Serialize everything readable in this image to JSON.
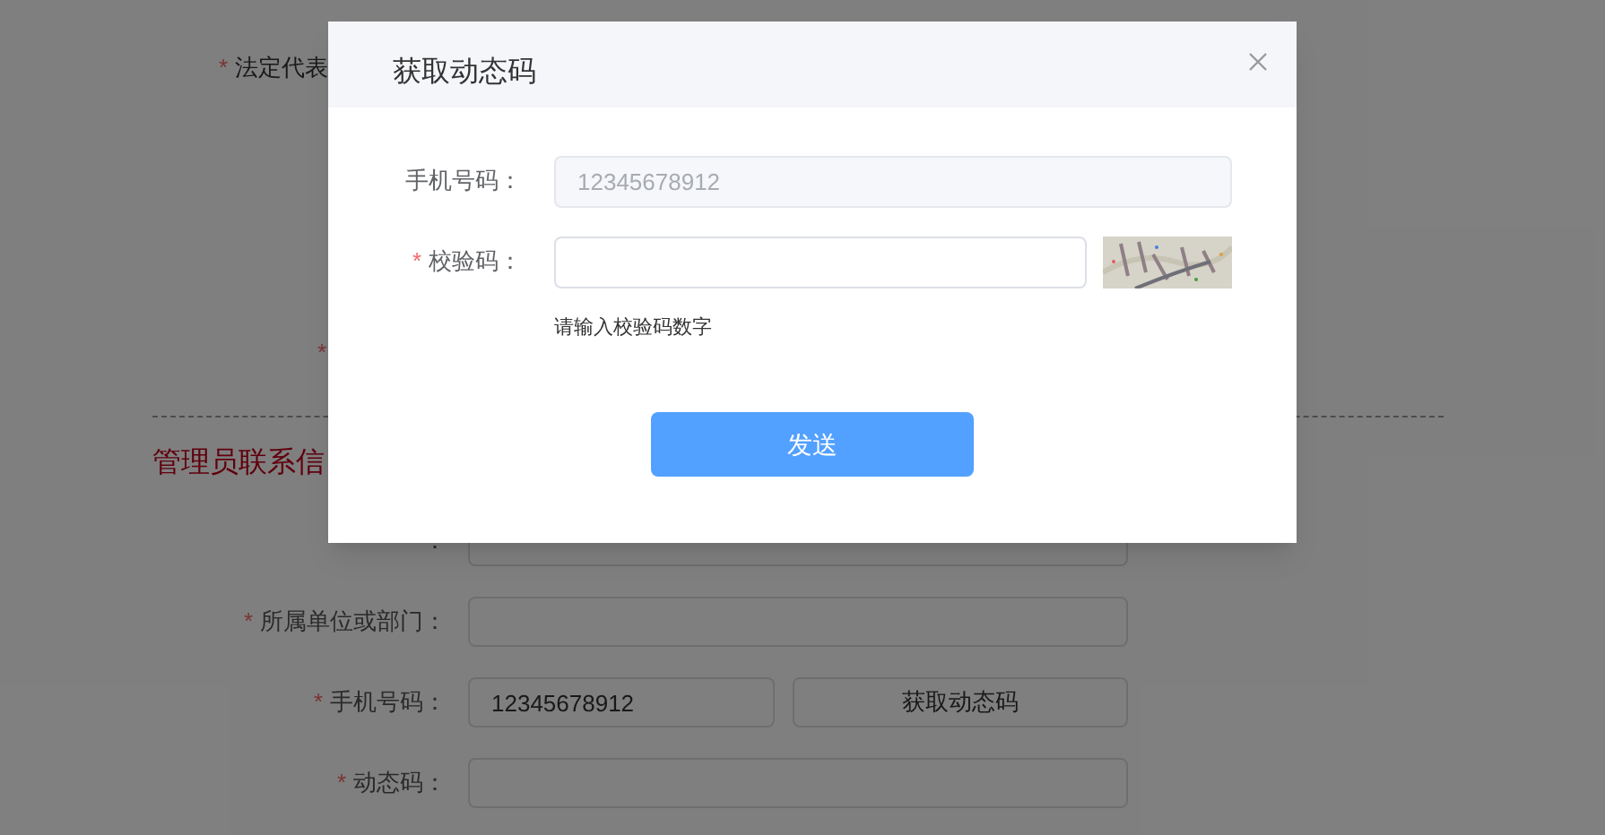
{
  "background": {
    "rows": [
      {
        "kind": "covered",
        "label": "法定代表",
        "mark": "*"
      },
      {
        "kind": "mark",
        "mark": "*"
      },
      {
        "kind": "divider"
      },
      {
        "kind": "heading",
        "label": "管理员联系信"
      },
      {
        "kind": "field",
        "label": "："
      },
      {
        "kind": "field",
        "label": "所属单位或部门：",
        "mark": "*"
      },
      {
        "kind": "field_button",
        "label": "手机号码：",
        "mark": "*",
        "value": "12345678912",
        "button": "获取动态码"
      },
      {
        "kind": "field",
        "label": "动态码：",
        "mark": "*"
      }
    ]
  },
  "dialog": {
    "title": "获取动态码",
    "fields": [
      {
        "kind": "text",
        "label": "手机号码：",
        "value": "12345678912",
        "disabled": true
      },
      {
        "kind": "captcha",
        "label": "校验码：",
        "mark": "*",
        "hint": "请输入校验码数字"
      }
    ],
    "button": "发送"
  }
}
